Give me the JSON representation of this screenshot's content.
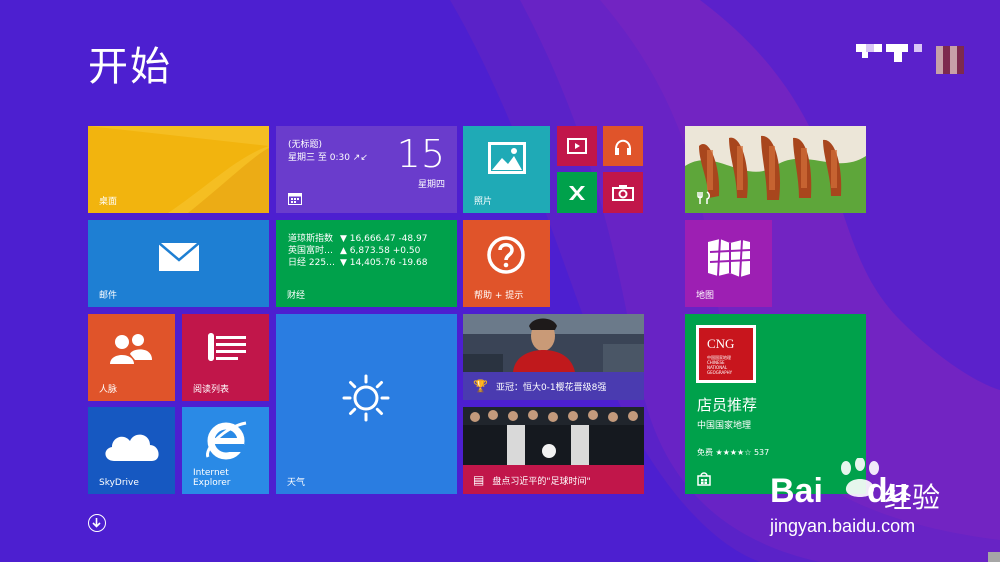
{
  "colors": {
    "background": "#4d1fd0",
    "tile_orange": "#f2b40e",
    "tile_blue": "#2a7de1",
    "tile_cal": "#6a3ccc",
    "tile_green": "#00a14b",
    "tile_red": "#e0542a",
    "tile_crimson": "#c1164a",
    "tile_teal": "#1faab6",
    "tile_purple": "#9d1fb3"
  },
  "start": {
    "title": "开始"
  },
  "tiles": {
    "desktop": {
      "label": "桌面"
    },
    "calendar": {
      "event": "(无标题)",
      "time": "星期三 至 0:30 ↗↙",
      "day": "15",
      "weekday": "星期四"
    },
    "photos": {
      "label": "照片"
    },
    "video": {
      "icon": "video-icon"
    },
    "music": {
      "icon": "headphones-icon"
    },
    "games": {
      "icon": "xbox-icon"
    },
    "camera": {
      "icon": "camera-icon"
    },
    "food": {
      "icon": "fork-knife-icon"
    },
    "mail": {
      "label": "邮件"
    },
    "finance": {
      "label": "财经",
      "rows": [
        {
          "name": "道琼斯指数",
          "value": "▼ 16,666.47 -48.97"
        },
        {
          "name": "英国富时…",
          "value": "▲ 6,873.58 +0.50"
        },
        {
          "name": "日经 225…",
          "value": "▼ 14,405.76 -19.68"
        }
      ]
    },
    "help": {
      "label": "帮助 + 提示"
    },
    "maps": {
      "label": "地图"
    },
    "people": {
      "label": "人脉"
    },
    "reading": {
      "label": "阅读列表"
    },
    "weather": {
      "label": "天气"
    },
    "sports": {
      "caption": "亚冠：恒大0-1樱花晋级8强"
    },
    "news": {
      "caption": "盘点习近平的\"足球时间\""
    },
    "store": {
      "logo": "CNG",
      "logo_sub": "中国国家地理 CHINESE NATIONAL GEOGRAPHY",
      "title": "店员推荐",
      "publisher": "中国国家地理",
      "rating": "免费 ★★★★☆ 537"
    },
    "skydrive": {
      "label": "SkyDrive"
    },
    "ie": {
      "label": "Internet\nExplorer"
    }
  },
  "watermark": {
    "brand": "Bai",
    "brand2": "du",
    "cn": "经验",
    "url": "jingyan.baidu.com"
  }
}
